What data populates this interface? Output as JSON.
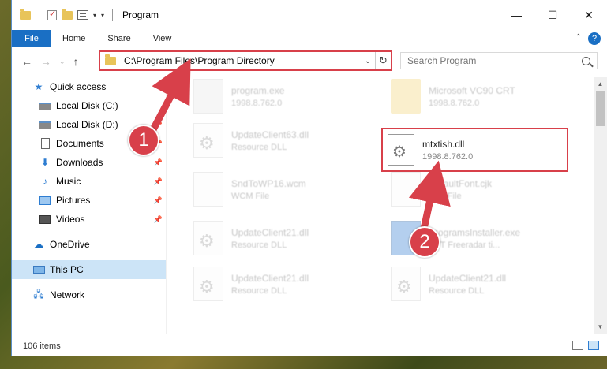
{
  "window": {
    "title": "Program",
    "controls": {
      "minimize": "—",
      "maximize": "☐",
      "close": "✕"
    }
  },
  "ribbon": {
    "tabs": [
      "File",
      "Home",
      "Share",
      "View"
    ],
    "help": "?",
    "collapse": "⌃"
  },
  "address": {
    "path": "C:\\Program Files\\Program Directory",
    "dropdown": "⌄",
    "refresh": "↻"
  },
  "search": {
    "placeholder": "Search Program"
  },
  "sidebar": {
    "items": [
      {
        "label": "Quick access",
        "icon": "star-icon",
        "pinned": false
      },
      {
        "label": "Local Disk (C:)",
        "icon": "disk-icon",
        "pinned": false
      },
      {
        "label": "Local Disk (D:)",
        "icon": "disk-icon",
        "pinned": true
      },
      {
        "label": "Documents",
        "icon": "documents-icon",
        "pinned": true
      },
      {
        "label": "Downloads",
        "icon": "downloads-icon",
        "pinned": true
      },
      {
        "label": "Music",
        "icon": "music-icon",
        "pinned": true
      },
      {
        "label": "Pictures",
        "icon": "pictures-icon",
        "pinned": true
      },
      {
        "label": "Videos",
        "icon": "videos-icon",
        "pinned": true
      },
      {
        "label": "OneDrive",
        "icon": "onedrive-icon",
        "pinned": false
      },
      {
        "label": "This PC",
        "icon": "this-pc-icon",
        "pinned": false,
        "selected": true
      },
      {
        "label": "Network",
        "icon": "network-icon",
        "pinned": false
      }
    ]
  },
  "files": [
    {
      "name": "program.exe",
      "meta": "1998.8.762.0",
      "kind": "exe"
    },
    {
      "name": "Microsoft VC90 CRT",
      "meta": "1998.8.762.0",
      "kind": "folder"
    },
    {
      "name": "UpdateClient63.dll",
      "meta": "Resource DLL",
      "kind": "dll"
    },
    {
      "name": "SndToWP16.wcm",
      "meta": "WCM File",
      "kind": "doc"
    },
    {
      "name": "DefaultFont.cjk",
      "meta": "CJK File",
      "kind": "doc"
    },
    {
      "name": "UpdateClient21.dll",
      "meta": "Resource DLL",
      "kind": "dll"
    },
    {
      "name": "ProgramsInstaller.exe",
      "meta": "EST Freeradar ti...",
      "kind": "blue"
    },
    {
      "name": "UpdateClient21.dll",
      "meta": "Resource DLL",
      "kind": "dll"
    },
    {
      "name": "UpdateClient21.dll",
      "meta": "Resource DLL",
      "kind": "dll"
    }
  ],
  "highlighted_file": {
    "name": "mtxtish.dll",
    "meta": "1998.8.762.0"
  },
  "status": {
    "count": "106 items"
  },
  "annotations": {
    "step1": "1",
    "step2": "2",
    "color": "#d8404a"
  }
}
